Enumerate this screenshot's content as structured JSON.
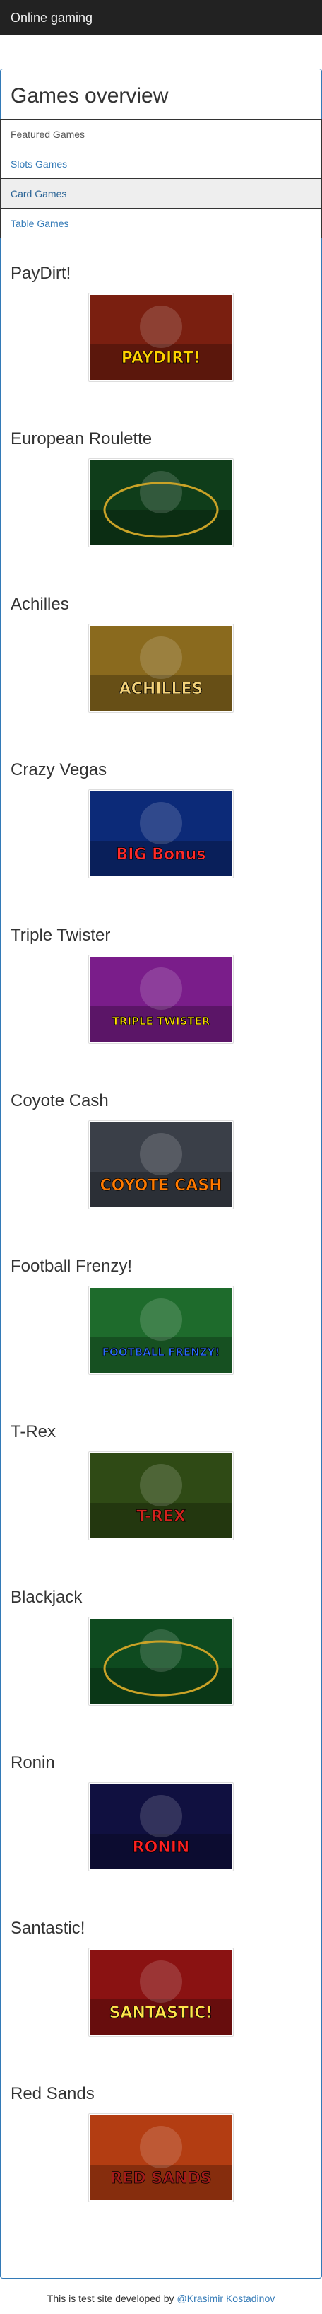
{
  "navbar": {
    "brand": "Online gaming"
  },
  "panel": {
    "title": "Games overview"
  },
  "nav": {
    "header": "Featured Games",
    "items": [
      {
        "label": "Slots Games",
        "active": false
      },
      {
        "label": "Card Games",
        "active": true
      },
      {
        "label": "Table Games",
        "active": false
      }
    ]
  },
  "games": [
    {
      "title": "PayDirt!",
      "logo": "PAYDIRT!",
      "icon": "paydirt-game-thumbnail",
      "bg": "#7a1f10",
      "fg": "#ffd200"
    },
    {
      "title": "European Roulette",
      "logo": "",
      "icon": "roulette-game-thumbnail",
      "bg": "#0f3d1a",
      "fg": "#ffffff"
    },
    {
      "title": "Achilles",
      "logo": "ACHILLES",
      "icon": "achilles-game-thumbnail",
      "bg": "#8a6a1e",
      "fg": "#f3d27a"
    },
    {
      "title": "Crazy Vegas",
      "logo": "BIG Bonus",
      "icon": "crazy-vegas-game-thumbnail",
      "bg": "#0c2a78",
      "fg": "#ff2a2a"
    },
    {
      "title": "Triple Twister",
      "logo": "TRIPLE TWISTER",
      "icon": "triple-twister-game-thumbnail",
      "bg": "#7a1d8a",
      "fg": "#ffe000"
    },
    {
      "title": "Coyote Cash",
      "logo": "COYOTE CASH",
      "icon": "coyote-cash-game-thumbnail",
      "bg": "#3a3f48",
      "fg": "#ff7a00"
    },
    {
      "title": "Football Frenzy!",
      "logo": "FOOTBALL FRENZY!",
      "icon": "football-frenzy-game-thumbnail",
      "bg": "#1e6b2c",
      "fg": "#2b6fff"
    },
    {
      "title": "T-Rex",
      "logo": "T-REX",
      "icon": "t-rex-game-thumbnail",
      "bg": "#2f4a15",
      "fg": "#d4231d"
    },
    {
      "title": "Blackjack",
      "logo": "",
      "icon": "blackjack-game-thumbnail",
      "bg": "#0e4a1f",
      "fg": "#ffffff"
    },
    {
      "title": "Ronin",
      "logo": "RONIN",
      "icon": "ronin-game-thumbnail",
      "bg": "#101040",
      "fg": "#ff2020"
    },
    {
      "title": "Santastic!",
      "logo": "SANTASTIC!",
      "icon": "santastic-game-thumbnail",
      "bg": "#8a1212",
      "fg": "#ffe34a"
    },
    {
      "title": "Red Sands",
      "logo": "RED SANDS",
      "icon": "red-sands-game-thumbnail",
      "bg": "#b33d12",
      "fg": "#a51b1b"
    }
  ],
  "footer": {
    "text": "This is test site developed by",
    "link": "@Krasimir Kostadinov"
  }
}
